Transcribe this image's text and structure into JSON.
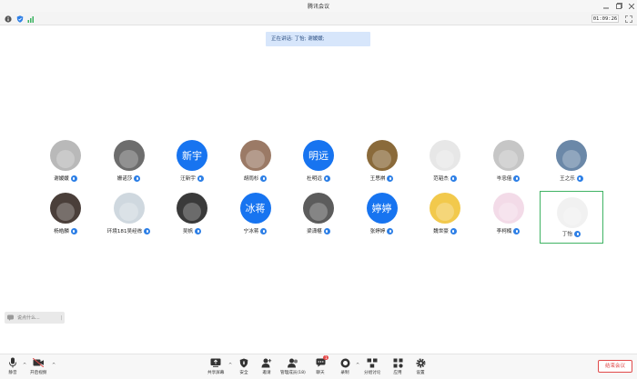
{
  "window": {
    "title": "腾讯会议"
  },
  "status": {
    "timer": "01:09:26"
  },
  "speaking": {
    "text": "正在讲话: 丁怡; 谢媛媛;"
  },
  "participants": [
    {
      "name": "谢媛媛",
      "avatar": "photo",
      "color": "#b9b9b9"
    },
    {
      "name": "姗诺莎",
      "avatar": "photo",
      "color": "#6d6d6d"
    },
    {
      "name": "汪新宇",
      "avatar": "text",
      "avatar_text": "新宇"
    },
    {
      "name": "胡雨杉",
      "avatar": "photo",
      "color": "#9b7a66"
    },
    {
      "name": "杜明远",
      "avatar": "text",
      "avatar_text": "明远"
    },
    {
      "name": "王思祺",
      "avatar": "photo",
      "color": "#8a6a3a"
    },
    {
      "name": "范韬杰",
      "avatar": "photo",
      "color": "#e7e7e7"
    },
    {
      "name": "岑忠僖",
      "avatar": "photo",
      "color": "#c6c6c6"
    },
    {
      "name": "王之乐",
      "avatar": "photo",
      "color": "#6b88a8"
    },
    {
      "name": "杨皓麟",
      "avatar": "photo",
      "color": "#4a3f3a"
    },
    {
      "name": "环境181吴经栋",
      "avatar": "photo",
      "color": "#cfd8df"
    },
    {
      "name": "吴帆",
      "avatar": "photo",
      "color": "#3a3a3a"
    },
    {
      "name": "宁冰蒋",
      "avatar": "text",
      "avatar_text": "冰蒋"
    },
    {
      "name": "梁潇椹",
      "avatar": "photo",
      "color": "#5c5c5c"
    },
    {
      "name": "张婷婷",
      "avatar": "text",
      "avatar_text": "婷婷"
    },
    {
      "name": "魏世豪",
      "avatar": "photo",
      "color": "#f2c94c"
    },
    {
      "name": "李柯楠",
      "avatar": "photo",
      "color": "#f3dbe8"
    },
    {
      "name": "丁怡",
      "avatar": "photo",
      "color": "#f1f1f1",
      "active": true
    }
  ],
  "chat": {
    "placeholder": "说点什么..."
  },
  "toolbar": {
    "mute": "静音",
    "video": "开启视频",
    "share": "共享屏幕",
    "security": "安全",
    "invite": "邀请",
    "members": "管理成员(18)",
    "chat": "聊天",
    "chat_badge": "1",
    "record": "录制",
    "breakout": "分组讨论",
    "apps": "应用",
    "settings": "设置",
    "end": "结束会议"
  }
}
